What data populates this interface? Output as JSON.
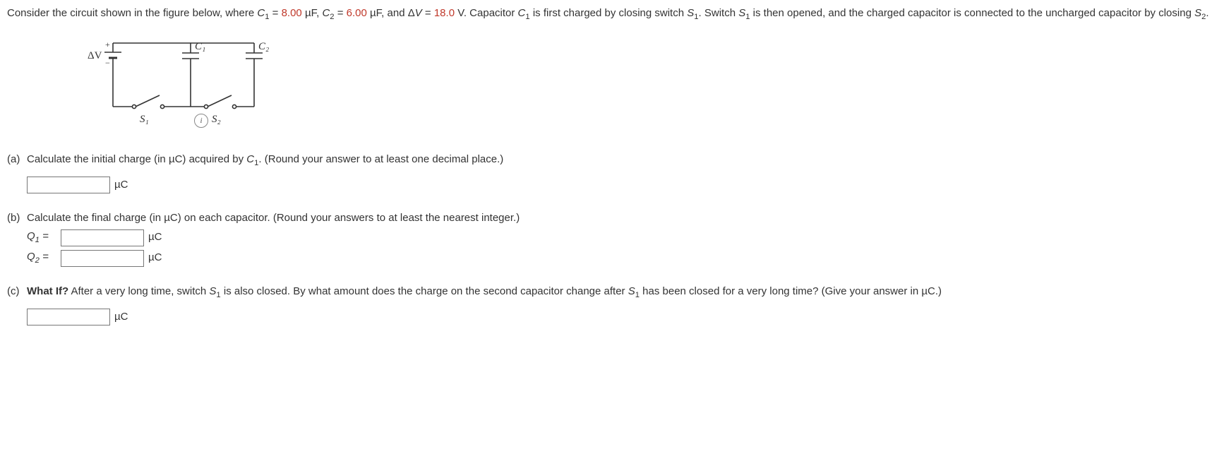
{
  "intro": {
    "prefix": "Consider the circuit shown in the figure below, where ",
    "c1_name": "C",
    "c1_sub": "1",
    "eq": " = ",
    "c1_val": "8.00",
    "uf": " µF, ",
    "c2_name": "C",
    "c2_sub": "2",
    "c2_val": "6.00",
    "uf2": " µF, and Δ",
    "dv_name": "V",
    "dv_val": "18.0",
    "dv_unit": " V. Capacitor ",
    "c1b_name": "C",
    "c1b_sub": "1",
    "mid1": " is first charged by closing switch ",
    "s1_name": "S",
    "s1_sub": "1",
    "mid2": ". Switch ",
    "s1b_name": "S",
    "s1b_sub": "1",
    "mid3": " is then opened, and the charged capacitor is connected to the uncharged capacitor by closing ",
    "s2_name": "S",
    "s2_sub": "2",
    "period": "."
  },
  "figure": {
    "dv": "ΔV",
    "plus": "+",
    "minus": "−",
    "c1": "C₁",
    "c2": "C₂",
    "s1": "S₁",
    "s2": "S₂",
    "info": "i"
  },
  "a": {
    "label": "(a)",
    "text_pre": "Calculate the initial charge (in µC) acquired by ",
    "c_name": "C",
    "c_sub": "1",
    "text_post": ". (Round your answer to at least one decimal place.)",
    "unit": "µC"
  },
  "b": {
    "label": "(b)",
    "text": "Calculate the final charge (in µC) on each capacitor. (Round your answers to at least the nearest integer.)",
    "q1_label": "Q",
    "q1_sub": "1",
    "q2_label": "Q",
    "q2_sub": "2",
    "eq": " = ",
    "unit": "µC"
  },
  "c": {
    "label": "(c)",
    "bold": "What If?",
    "text_pre": " After a very long time, switch ",
    "s1_name": "S",
    "s1_sub": "1",
    "text_mid": " is also closed. By what amount does the charge on the second capacitor change after ",
    "s1b_name": "S",
    "s1b_sub": "1",
    "text_post": " has been closed for a very long time? (Give your answer in µC.)",
    "unit": "µC"
  }
}
